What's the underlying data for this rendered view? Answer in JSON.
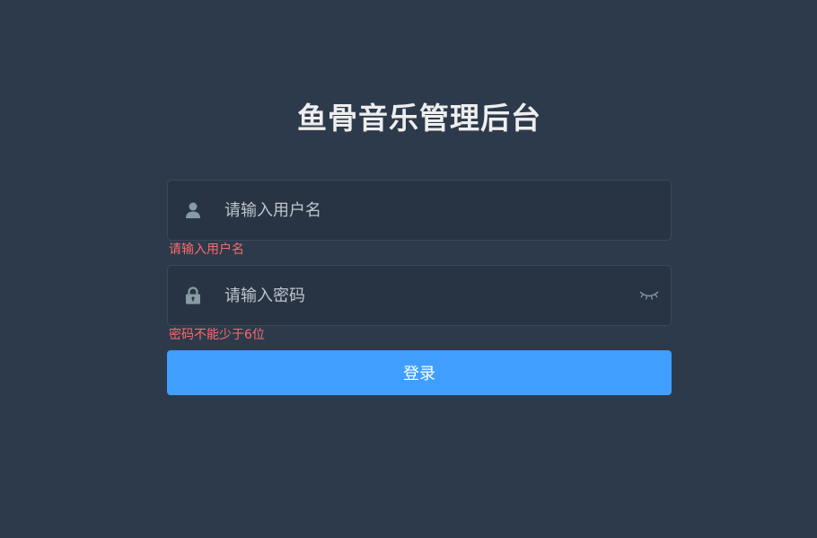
{
  "title": "鱼骨音乐管理后台",
  "username": {
    "value": "",
    "placeholder": "请输入用户名",
    "icon": "user-icon",
    "error": "请输入用户名"
  },
  "password": {
    "value": "",
    "placeholder": "请输入密码",
    "icon": "lock-icon",
    "toggle_icon": "eye-closed-icon",
    "error": "密码不能少于6位"
  },
  "login_button": "登录",
  "colors": {
    "background": "#2d3a4b",
    "input_background": "#283443",
    "title": "#eeeeee",
    "error": "#f56c6c",
    "primary": "#409eff",
    "icon": "#889aa4"
  }
}
